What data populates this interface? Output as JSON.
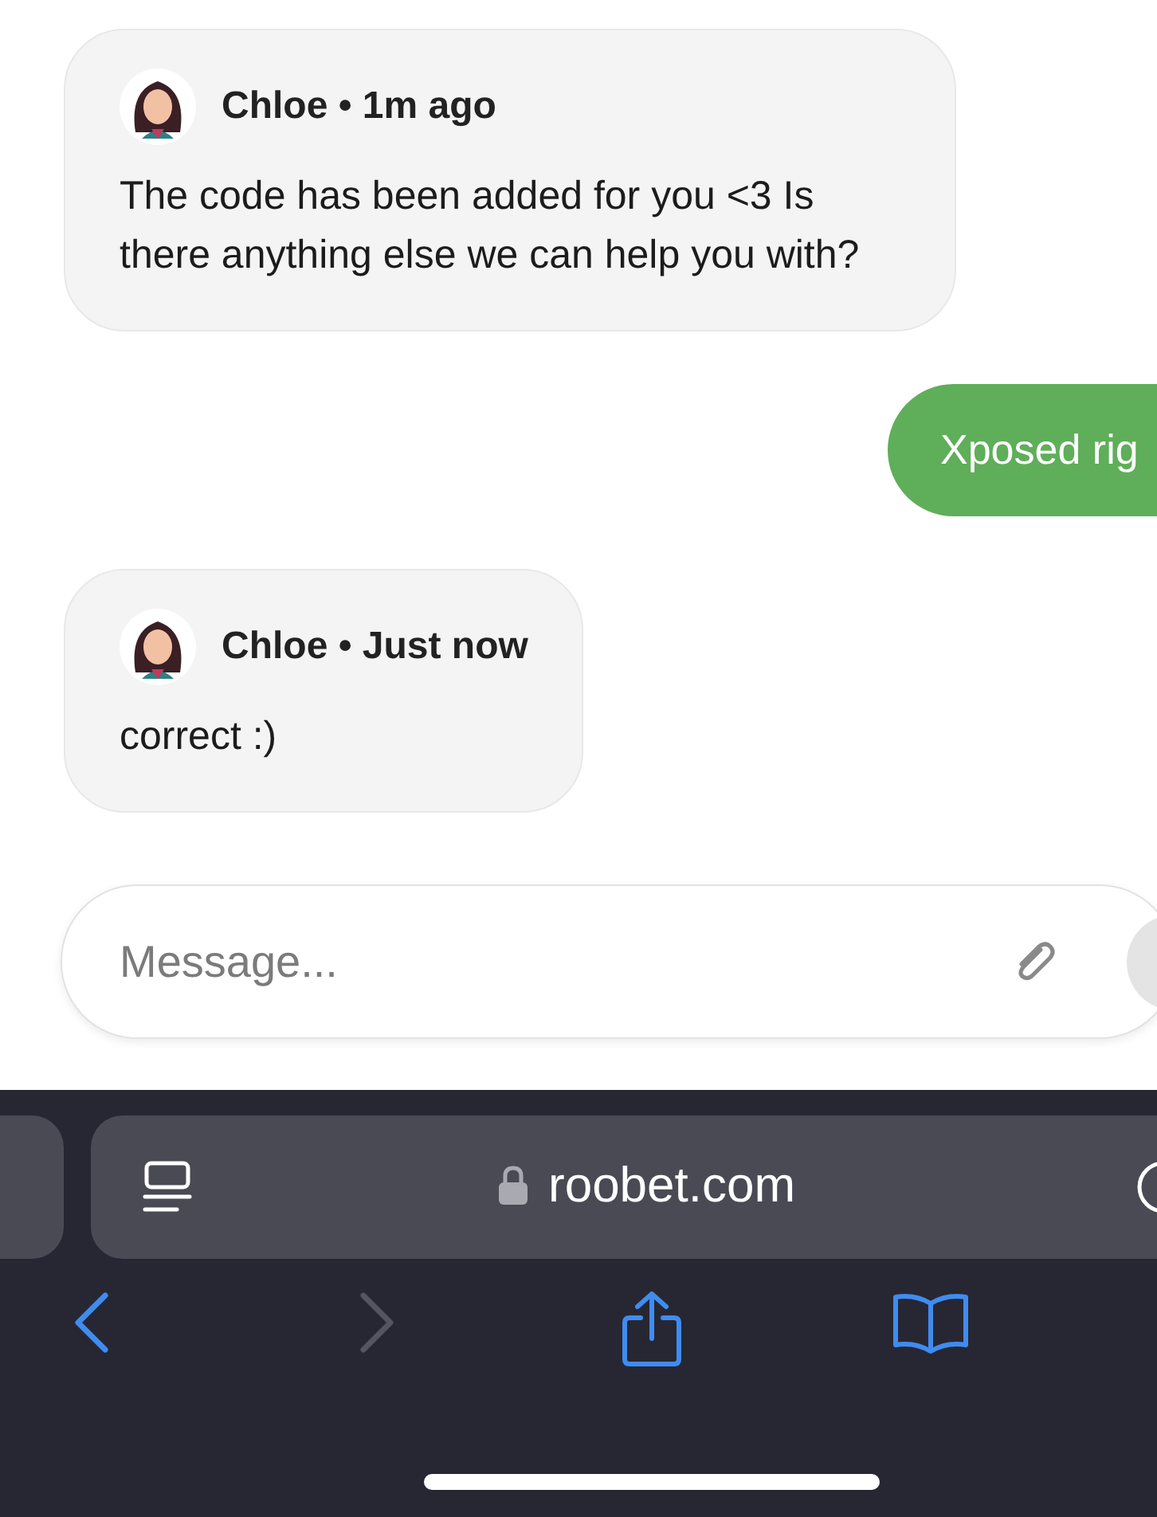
{
  "messages": [
    {
      "kind": "agent",
      "header": "Chloe • 1m ago",
      "text": "The code has been added for you <3 Is there anything else we can help you with?"
    },
    {
      "kind": "user",
      "text": "Xposed rig"
    },
    {
      "kind": "agent",
      "header": "Chloe • Just now",
      "text": "correct :)"
    }
  ],
  "composer": {
    "placeholder": "Message..."
  },
  "browser": {
    "url": "roobet.com",
    "secure": true,
    "toolbar": [
      {
        "kind": "back",
        "disabled": false
      },
      {
        "kind": "forward",
        "disabled": true
      },
      {
        "kind": "share",
        "disabled": false
      },
      {
        "kind": "bookmarks",
        "disabled": false
      }
    ]
  }
}
